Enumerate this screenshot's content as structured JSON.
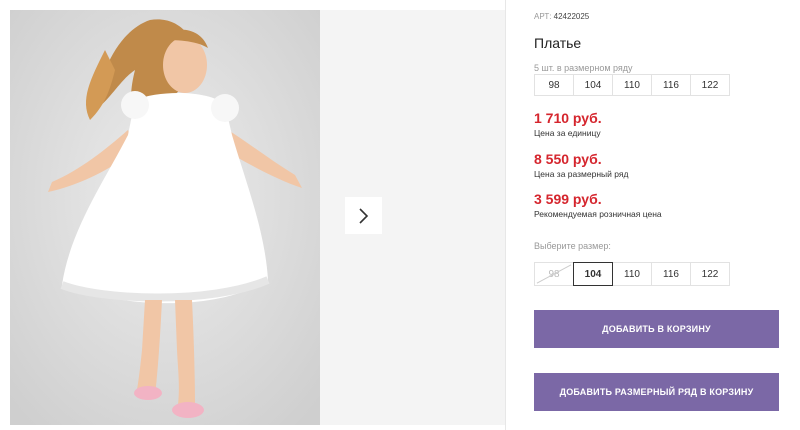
{
  "gallery": {
    "photo_alt": "",
    "next_icon": "chevron-right-icon"
  },
  "product": {
    "article_prefix": "АРТ:",
    "article_value": "42422025",
    "title": "Платье",
    "sizes_note": "5 шт. в размерном ряду",
    "size_run": [
      "98",
      "104",
      "110",
      "116",
      "122"
    ],
    "price_unit": "1 710 руб.",
    "price_unit_label": "Цена за единицу",
    "price_run": "8 550 руб.",
    "price_run_label": "Цена за размерный ряд",
    "price_retail": "3 599 руб.",
    "price_retail_label": "Рекомендуемая розничная цена",
    "choose_size_label": "Выберите размер:",
    "size_options": [
      {
        "label": "98",
        "state": "disabled"
      },
      {
        "label": "104",
        "state": "selected"
      },
      {
        "label": "110",
        "state": "available"
      },
      {
        "label": "116",
        "state": "available"
      },
      {
        "label": "122",
        "state": "available"
      }
    ],
    "add_to_cart": "ДОБАВИТЬ В КОРЗИНУ",
    "add_run_to_cart": "ДОБАВИТЬ РАЗМЕРНЫЙ РЯД В КОРЗИНУ"
  },
  "colors": {
    "accent": "#7b68a6",
    "price": "#d5252d"
  }
}
